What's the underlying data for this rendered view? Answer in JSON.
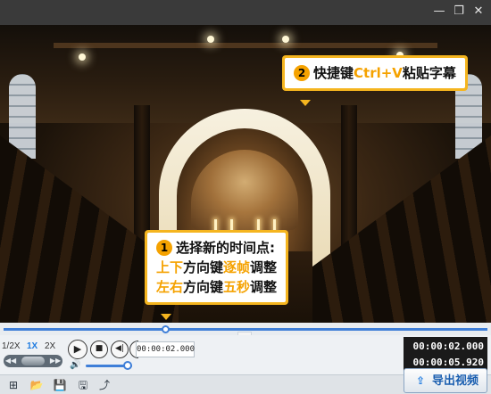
{
  "window": {
    "minimize_icon": "minimize-icon",
    "restore_icon": "restore-icon",
    "close_icon": "close-icon",
    "minimize_glyph": "—",
    "restore_glyph": "❐",
    "close_glyph": "✕"
  },
  "callouts": {
    "top": {
      "number": "2",
      "prefix": "快捷键",
      "highlight": "Ctrl+V",
      "suffix": "粘贴字幕"
    },
    "bottom": {
      "number": "1",
      "line1": "选择新的时间点:",
      "line2_a": "上下",
      "line2_b": "方向键",
      "line2_c": "逐帧",
      "line2_d": "调整",
      "line3_a": "左右",
      "line3_b": "方向键",
      "line3_c": "五秒",
      "line3_d": "调整"
    }
  },
  "timeline": {
    "progress": 0.338,
    "chevron_glyph": "⌄"
  },
  "controls": {
    "speeds": [
      "1/2X",
      "1X",
      "2X"
    ],
    "active_speed": "1X",
    "jog_left": "◀◀",
    "jog_right": "▶▶",
    "play_glyph": "▶",
    "stop_glyph": "■",
    "prev_glyph": "◀|",
    "next_glyph": "|▶",
    "current_time_field": "00:00:02.000",
    "volume": 0.9,
    "volume_glyph": "🔊",
    "current_time": "00:00:02.000",
    "total_time": "00:00:05.920"
  },
  "toolbar": {
    "new_glyph": "⊞",
    "open_glyph": "📂",
    "save_glyph": "💾",
    "save_as_glyph": "🖫",
    "share_glyph": "⤴",
    "export_label": "导出视频",
    "export_glyph": "⇪"
  },
  "colors": {
    "accent": "#f5a200",
    "callout_border": "#f5b51f",
    "timeline_blue": "#3f7fd8"
  }
}
